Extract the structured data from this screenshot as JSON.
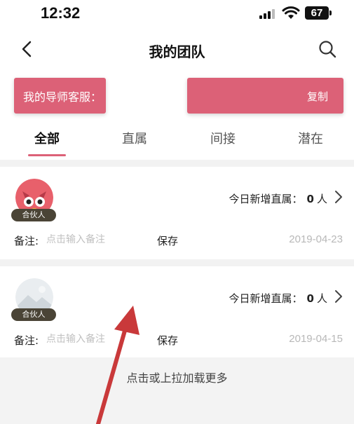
{
  "status_bar": {
    "time": "12:32",
    "battery": "67"
  },
  "header": {
    "title": "我的团队"
  },
  "mentor_banner": {
    "label": "我的导师客服：",
    "copy_label": "复制"
  },
  "tabs": [
    {
      "label": "全部",
      "active": true
    },
    {
      "label": "直属",
      "active": false
    },
    {
      "label": "间接",
      "active": false
    },
    {
      "label": "潜在",
      "active": false
    }
  ],
  "members": [
    {
      "badge": "合伙人",
      "stat_label": "今日新增直属：",
      "stat_value": "0",
      "stat_unit": "人",
      "remark_label": "备注:",
      "remark_placeholder": "点击输入备注",
      "save_label": "保存",
      "date": "2019-04-23",
      "avatar": "red-owl-avatar"
    },
    {
      "badge": "合伙人",
      "stat_label": "今日新增直属：",
      "stat_value": "0",
      "stat_unit": "人",
      "remark_label": "备注:",
      "remark_placeholder": "点击输入备注",
      "save_label": "保存",
      "date": "2019-04-15",
      "avatar": "default-landscape-avatar"
    }
  ],
  "load_more": "点击或上拉加载更多",
  "colors": {
    "accent": "#dc6177",
    "badge_bg": "#4a4436",
    "annotation_arrow": "#c9393a"
  }
}
